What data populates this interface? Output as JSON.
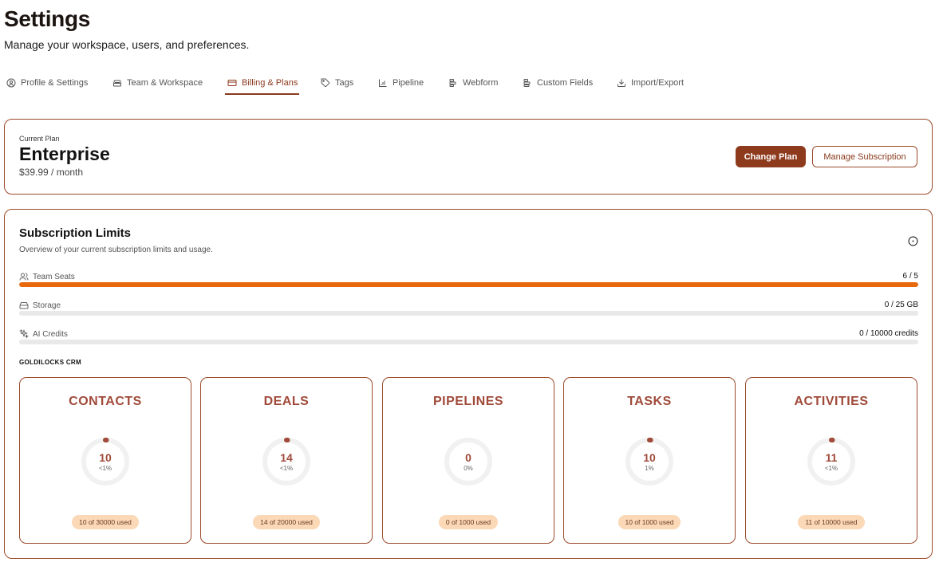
{
  "header": {
    "title": "Settings",
    "subtitle": "Manage your workspace, users, and preferences."
  },
  "tabs": [
    {
      "label": "Profile & Settings",
      "icon": "user-circle-icon",
      "active": false
    },
    {
      "label": "Team & Workspace",
      "icon": "building-icon",
      "active": false
    },
    {
      "label": "Billing & Plans",
      "icon": "credit-card-icon",
      "active": true
    },
    {
      "label": "Tags",
      "icon": "tag-icon",
      "active": false
    },
    {
      "label": "Pipeline",
      "icon": "bar-chart-icon",
      "active": false
    },
    {
      "label": "Webform",
      "icon": "form-icon",
      "active": false
    },
    {
      "label": "Custom Fields",
      "icon": "fields-icon",
      "active": false
    },
    {
      "label": "Import/Export",
      "icon": "download-icon",
      "active": false
    }
  ],
  "plan": {
    "label": "Current Plan",
    "name": "Enterprise",
    "price": "$39.99 / month",
    "change_button": "Change Plan",
    "manage_button": "Manage Subscription"
  },
  "limits": {
    "title": "Subscription Limits",
    "description": "Overview of your current subscription limits and usage.",
    "rows": [
      {
        "label": "Team Seats",
        "value": "6 / 5",
        "icon": "users-icon",
        "fill_fraction": 1.0
      },
      {
        "label": "Storage",
        "value": "0 / 25 GB",
        "icon": "hard-drive-icon",
        "fill_fraction": 0.0
      },
      {
        "label": "AI Credits",
        "value": "0 / 10000 credits",
        "icon": "sparkles-icon",
        "fill_fraction": 0.0
      }
    ],
    "section_label": "GOLDILOCKS CRM",
    "usage": [
      {
        "title": "CONTACTS",
        "value": "10",
        "percent": "<1%",
        "used": "10 of 30000 used",
        "fraction": 0.0003
      },
      {
        "title": "DEALS",
        "value": "14",
        "percent": "<1%",
        "used": "14 of 20000 used",
        "fraction": 0.0007
      },
      {
        "title": "PIPELINES",
        "value": "0",
        "percent": "0%",
        "used": "0 of 1000 used",
        "fraction": 0.0
      },
      {
        "title": "TASKS",
        "value": "10",
        "percent": "1%",
        "used": "10 of 1000 used",
        "fraction": 0.01
      },
      {
        "title": "ACTIVITIES",
        "value": "11",
        "percent": "<1%",
        "used": "11 of 10000 used",
        "fraction": 0.0011
      }
    ]
  },
  "colors": {
    "accent": "#8e3a1d",
    "usage_title": "#a04a3a",
    "bar_fill": "#e8680c",
    "pill_bg": "#fbd8b6"
  }
}
